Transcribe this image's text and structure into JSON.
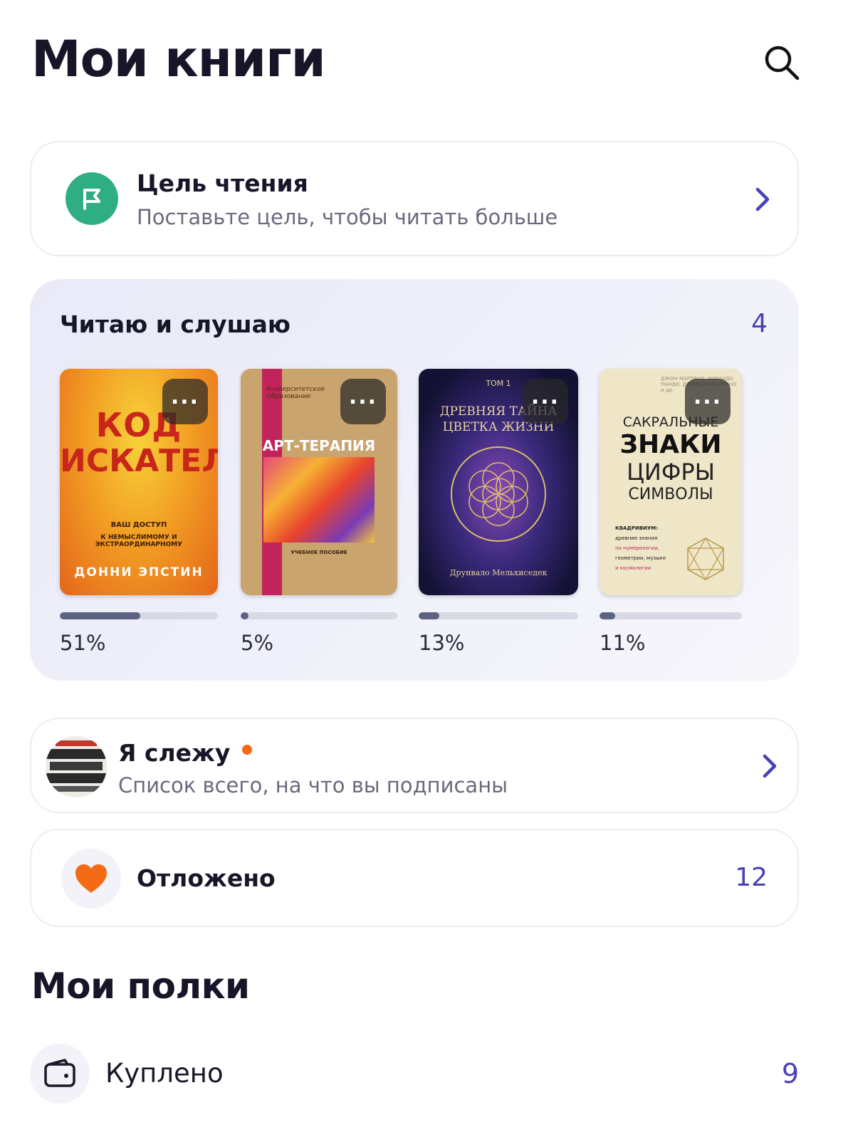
{
  "header": {
    "title": "Мои книги",
    "search_icon": "search-icon"
  },
  "goal": {
    "title": "Цель чтения",
    "subtitle": "Поставьте цель, чтобы читать больше",
    "icon": "flag-icon",
    "icon_color": "#2fae84"
  },
  "reading": {
    "title": "Читаю и слушаю",
    "count": "4",
    "books": [
      {
        "cover_title_1": "КОД",
        "cover_title_2": "ИСКАТЕЛЯ",
        "cover_sub_1": "ВАШ ДОСТУП",
        "cover_sub_2": "К НЕМЫСЛИМОМУ И ЭКСТРАОРДИНАРНОМУ",
        "cover_author": "ДОННИ ЭПСТИН",
        "progress": 0.51,
        "percent": "51%"
      },
      {
        "cover_series": "Университетское Образование",
        "cover_title": "АРТ-ТЕРАПИЯ",
        "cover_sub": "УЧЕБНОЕ ПОСОБИЕ",
        "progress": 0.05,
        "percent": "5%"
      },
      {
        "cover_tom": "ТОМ 1",
        "cover_title_1": "ДРЕВНЯЯ ТАЙНА",
        "cover_title_2": "ЦВЕТКА ЖИЗНИ",
        "cover_author": "Друнвало Мельхиседек",
        "progress": 0.13,
        "percent": "13%"
      },
      {
        "cover_authors": "ДЖОН МАРТИНО, МИРАНДА ПАНДИ, ДЖЕЙСОН МАРТИНО и др.",
        "cover_title_1": "САКРАЛЬНЫЕ",
        "cover_title_2": "ЗНАКИ",
        "cover_title_3": "ЦИФРЫ",
        "cover_title_4": "СИМВОЛЫ",
        "cover_sub_1": "КВАДРИВИУМ:",
        "cover_sub_2": "древние знания",
        "cover_sub_3": "по нумерологии,",
        "cover_sub_4": "геометрии, музыке",
        "cover_sub_5": "и космологии",
        "progress": 0.11,
        "percent": "11%"
      }
    ]
  },
  "follow": {
    "title": "Я слежу",
    "subtitle": "Список всего, на что вы подписаны",
    "dot_color": "#f56a14"
  },
  "saved": {
    "title": "Отложено",
    "count": "12",
    "icon": "heart-icon",
    "icon_color": "#f56a14"
  },
  "shelves": {
    "title": "Мои полки",
    "items": [
      {
        "label": "Куплено",
        "count": "9",
        "icon": "wallet-icon"
      }
    ]
  },
  "colors": {
    "accent": "#4840b8",
    "progress_fill": "#5b6282",
    "progress_track": "#d9d9e6"
  }
}
